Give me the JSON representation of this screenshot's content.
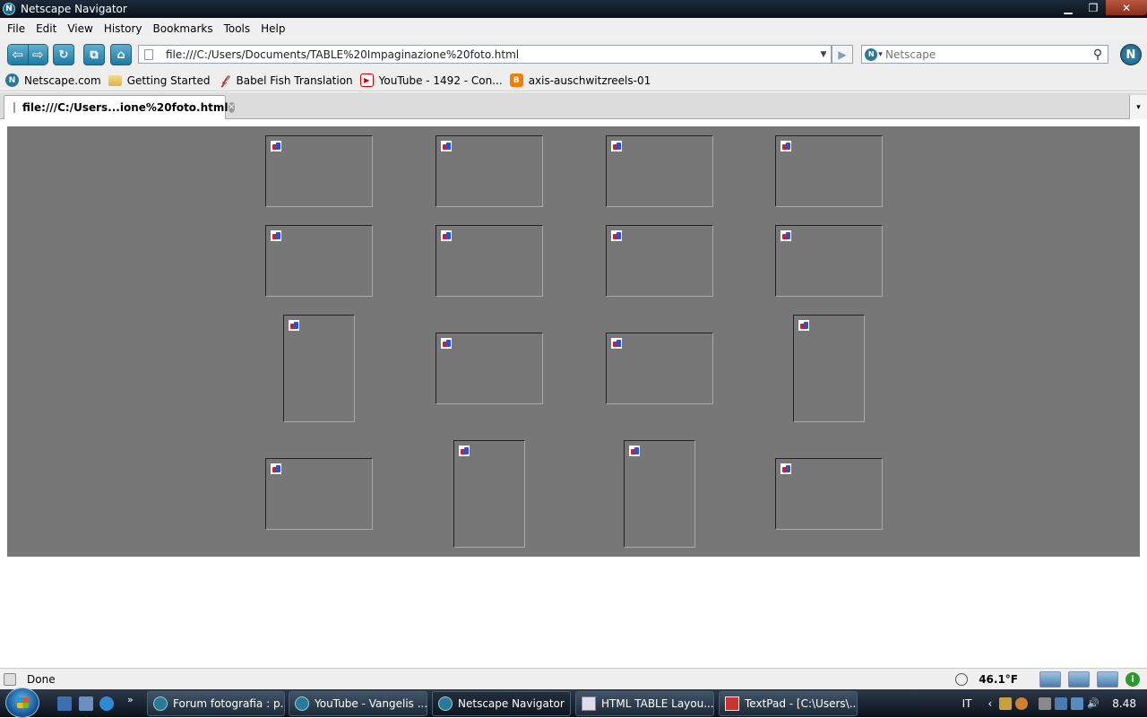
{
  "window": {
    "title": "Netscape Navigator"
  },
  "menu": {
    "items": [
      "File",
      "Edit",
      "View",
      "History",
      "Bookmarks",
      "Tools",
      "Help"
    ]
  },
  "navbar": {
    "url": "file:///C:/Users/Documents/TABLE%20Impaginazione%20foto.html",
    "search_placeholder": "Netscape"
  },
  "bookmarks": {
    "items": [
      "Netscape.com",
      "Getting Started",
      "Babel Fish Translation",
      "YouTube - 1492 - Con...",
      "axis-auschwitzreels-01"
    ]
  },
  "tabs": {
    "active_label": "file:///C:/Users...ione%20foto.html"
  },
  "status": {
    "text": "Done",
    "temperature": "46.1°F"
  },
  "taskbar": {
    "tasks": [
      "Forum fotografia : p...",
      "YouTube - Vangelis ...",
      "Netscape Navigator",
      "HTML TABLE Layou...",
      "TextPad - [C:\\Users\\..."
    ],
    "language": "IT",
    "clock": "8.48"
  }
}
